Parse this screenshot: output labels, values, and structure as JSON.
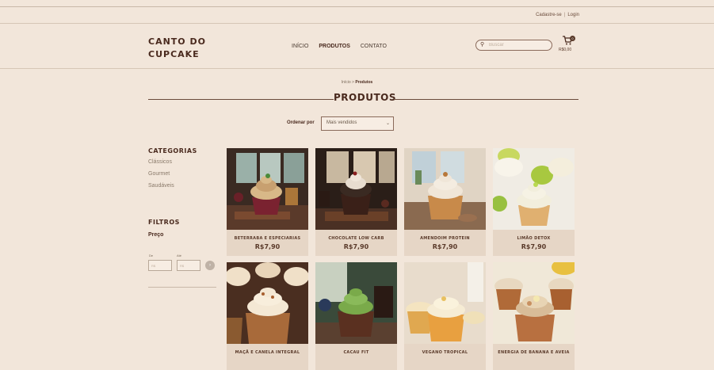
{
  "topbar": {
    "register": "Cadastre-se",
    "login": "Login"
  },
  "header": {
    "logo_line1": "CANTO DO",
    "logo_line2": "CUPCAKE",
    "nav": [
      "INÍCIO",
      "PRODUTOS",
      "CONTATO"
    ],
    "search_placeholder": "Buscar",
    "cart_count": "0",
    "cart_total": "R$0,00"
  },
  "breadcrumb": {
    "home": "Início",
    "separator": ">",
    "current": "Produtos"
  },
  "page_title": "PRODUTOS",
  "sort": {
    "label": "Ordenar por",
    "selected": "Mais vendidos"
  },
  "sidebar": {
    "categories_title": "CATEGORIAS",
    "categories": [
      "Clássicos",
      "Gourmet",
      "Saudáveis"
    ],
    "filters_title": "FILTROS",
    "price_label": "Preço",
    "from_label": "De",
    "to_label": "Até",
    "from_placeholder": "R$",
    "to_placeholder": "R$",
    "go_label": "›"
  },
  "products": [
    {
      "name": "BETERRABA E ESPECIARIAS",
      "price": "R$7,90"
    },
    {
      "name": "CHOCOLATE LOW CARB",
      "price": "R$7,90"
    },
    {
      "name": "AMENDOIM PROTEIN",
      "price": "R$7,90"
    },
    {
      "name": "LIMÃO DETOX",
      "price": "R$7,90"
    },
    {
      "name": "MAÇÃ E CANELA INTEGRAL",
      "price": ""
    },
    {
      "name": "CACAU FIT",
      "price": ""
    },
    {
      "name": "VEGANO TROPICAL",
      "price": ""
    },
    {
      "name": "ENERGIA DE BANANA E AVEIA",
      "price": ""
    }
  ],
  "colors": {
    "background": "#f2e6da",
    "brand": "#4a2a1e",
    "card_info": "#e6d6c6"
  }
}
